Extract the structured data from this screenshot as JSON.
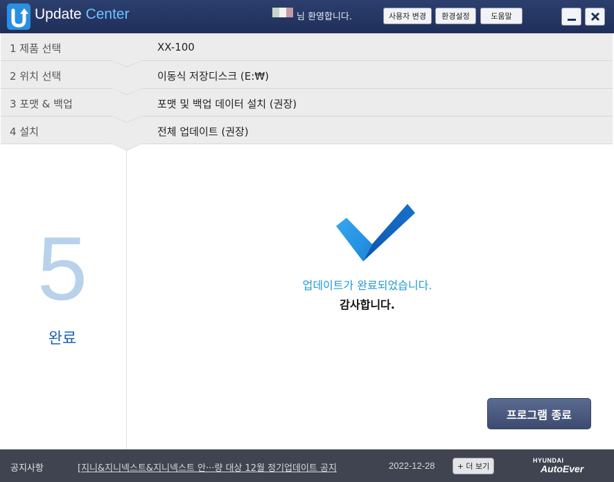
{
  "window": {
    "title_main": "Update ",
    "title_accent": "Center",
    "welcome": "님 환영합니다.",
    "user_swatch_colors": [
      "#c8d4c8",
      "#f2f2f2",
      "#c59aa8"
    ],
    "buttons": {
      "user_change": "사용자 변경",
      "settings": "환경설정",
      "help": "도움말"
    },
    "minimize_icon": "minimize-icon",
    "close_icon": "close-icon"
  },
  "steps": [
    {
      "num_label": "1  제품 선택",
      "value": "XX-100"
    },
    {
      "num_label": "2  위치 선택",
      "value": "이동식 저장디스크 (E:₩)"
    },
    {
      "num_label": "3  포맷 & 백업",
      "value": "포맷 및 백업 데이터 설치 (권장)"
    },
    {
      "num_label": "4  설치",
      "value": "전체 업데이트 (권장)"
    }
  ],
  "current_step": {
    "number": "5",
    "label": "완료"
  },
  "result": {
    "icon": "checkmark-icon",
    "message": "업데이트가 완료되었습니다.",
    "thanks": "감사합니다."
  },
  "exit_button": "프로그램 종료",
  "footer": {
    "notice_label": "공지사항",
    "notice_text": "[지니&지니넥스트&지니넥스트  안···량 대상 12월 정기업데이트 공지",
    "notice_date": "2022-12-28",
    "more_button": "+ 더 보기",
    "brand_top": "HYUNDAI",
    "brand_bottom": "AutoEver"
  },
  "colors": {
    "titlebar": "#24355f",
    "accent_blue": "#1f9ad6",
    "step_bg": "#ececec",
    "footer_bg": "#3f4450"
  }
}
